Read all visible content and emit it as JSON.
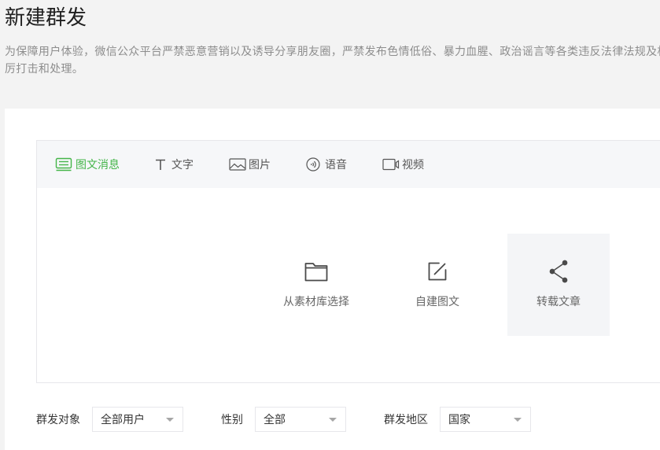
{
  "page": {
    "title": "新建群发",
    "notice_lines": [
      "为保障用户体验，微信公众平台严禁恶意营销以及诱导分享朋友圈，严禁发布色情低俗、暴力血腥、政治谣言等各类违反法律法规及相",
      "厉打击和处理。"
    ]
  },
  "editor": {
    "tabs": [
      {
        "label": "图文消息",
        "icon": "news-icon",
        "active": true
      },
      {
        "label": "文字",
        "icon": "text-icon",
        "active": false
      },
      {
        "label": "图片",
        "icon": "image-icon",
        "active": false
      },
      {
        "label": "语音",
        "icon": "voice-icon",
        "active": false
      },
      {
        "label": "视频",
        "icon": "video-icon",
        "active": false
      }
    ],
    "options": [
      {
        "label": "从素材库选择",
        "icon": "folder-icon",
        "hovered": false
      },
      {
        "label": "自建图文",
        "icon": "edit-icon",
        "hovered": false
      },
      {
        "label": "转载文章",
        "icon": "share-icon",
        "hovered": true
      }
    ]
  },
  "filters": {
    "target": {
      "label": "群发对象",
      "value": "全部用户"
    },
    "gender": {
      "label": "性别",
      "value": "全部"
    },
    "region": {
      "label": "群发地区",
      "value": "国家"
    }
  },
  "colors": {
    "accent": "#44b549",
    "page_bg": "#f3f3f3",
    "tabbar_bg": "#f6f7f9",
    "hover_bg": "#f4f5f7",
    "border": "#e7e7eb"
  }
}
